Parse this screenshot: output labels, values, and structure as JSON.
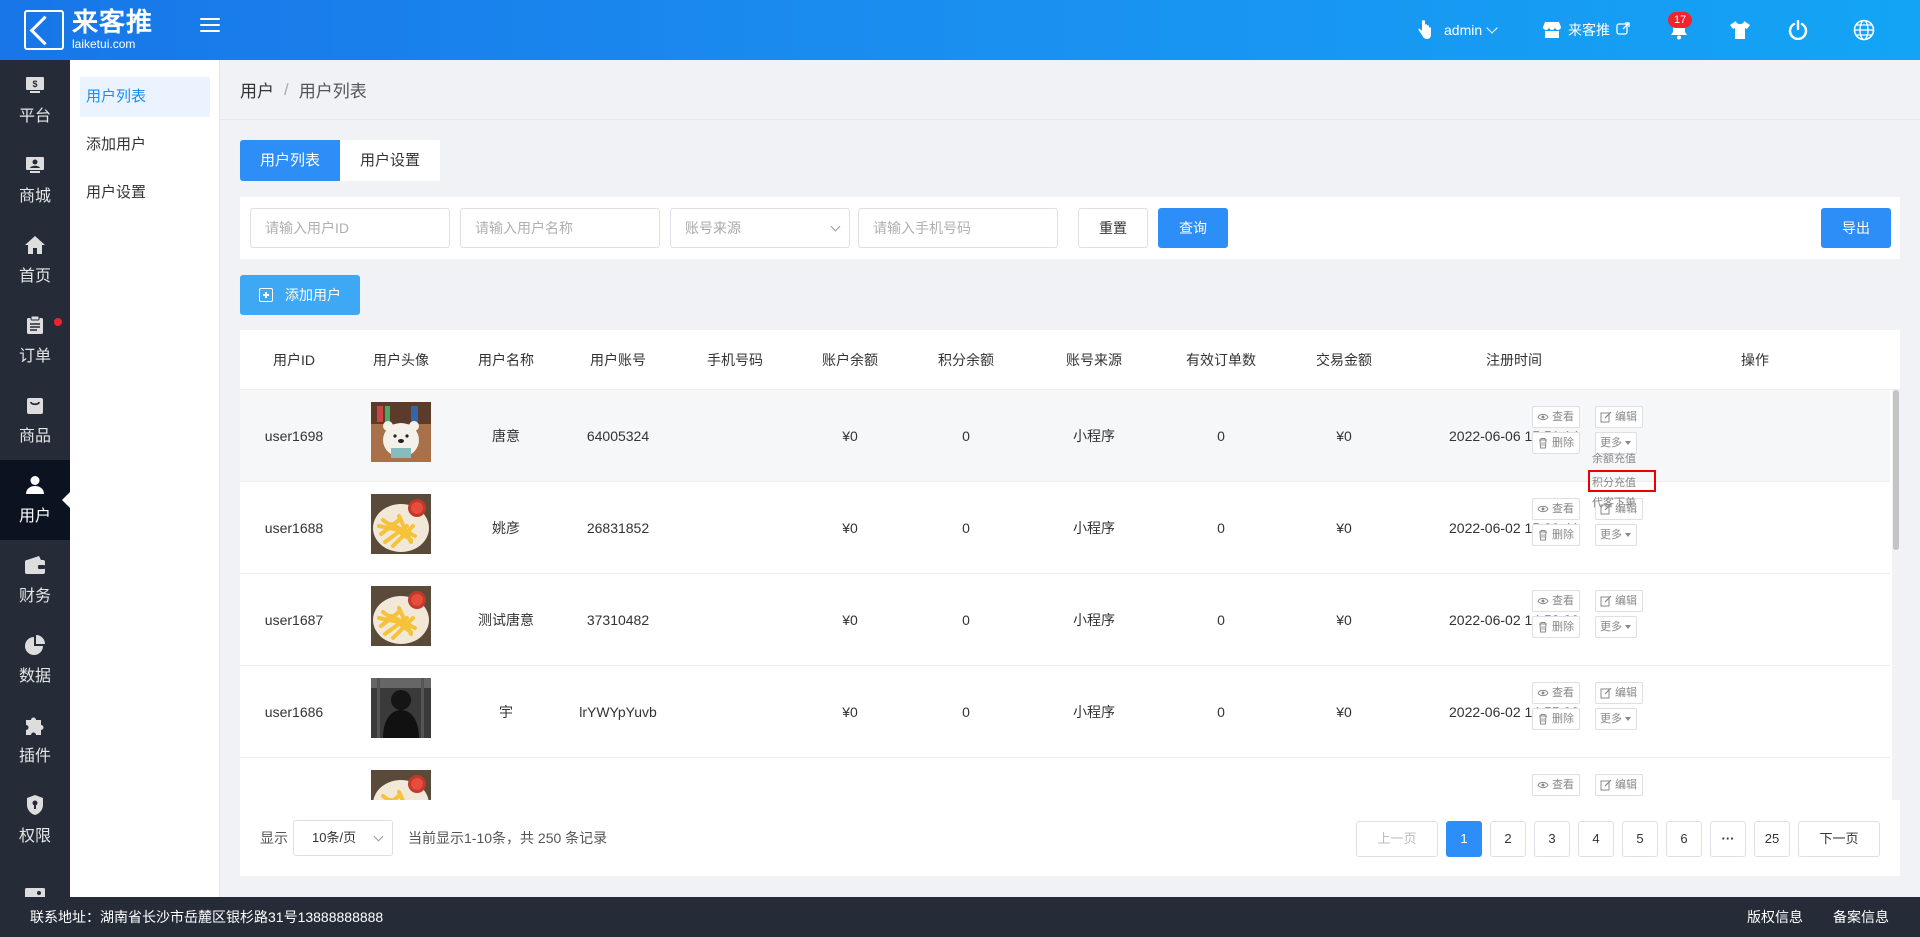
{
  "header": {
    "logo_text": "来客推",
    "logo_sub": "laiketui.com",
    "admin": "admin",
    "store": "来客推",
    "notif_count": "17"
  },
  "leftnav": [
    "平台",
    "商城",
    "首页",
    "订单",
    "商品",
    "用户",
    "财务",
    "数据",
    "插件",
    "权限"
  ],
  "subnav": [
    "用户列表",
    "添加用户",
    "用户设置"
  ],
  "breadcrumb": {
    "root": "用户",
    "sep": "/",
    "current": "用户列表"
  },
  "tabs": [
    "用户列表",
    "用户设置"
  ],
  "filter": {
    "user_id_ph": "请输入用户ID",
    "user_name_ph": "请输入用户名称",
    "source_ph": "账号来源",
    "phone_ph": "请输入手机号码",
    "reset": "重置",
    "query": "查询",
    "export": "导出"
  },
  "add_user": "添加用户",
  "table": {
    "headers": [
      "用户ID",
      "用户头像",
      "用户名称",
      "用户账号",
      "手机号码",
      "账户余额",
      "积分余额",
      "账号来源",
      "有效订单数",
      "交易金额",
      "注册时间",
      "操作"
    ],
    "rows": [
      {
        "id": "user1698",
        "name": "唐意",
        "account": "64005324",
        "phone": "",
        "balance": "¥0",
        "points": "0",
        "source": "小程序",
        "orders": "0",
        "amount": "¥0",
        "time": "2022-06-06 15:51:14",
        "avatar": "bear"
      },
      {
        "id": "user1688",
        "name": "姚彦",
        "account": "26831852",
        "phone": "",
        "balance": "¥0",
        "points": "0",
        "source": "小程序",
        "orders": "0",
        "amount": "¥0",
        "time": "2022-06-02 15:39:41",
        "avatar": "fries"
      },
      {
        "id": "user1687",
        "name": "测试唐意",
        "account": "37310482",
        "phone": "",
        "balance": "¥0",
        "points": "0",
        "source": "小程序",
        "orders": "0",
        "amount": "¥0",
        "time": "2022-06-02 14:58:30",
        "avatar": "fries"
      },
      {
        "id": "user1686",
        "name": "宇",
        "account": "lrYWYpYuvb",
        "phone": "",
        "balance": "¥0",
        "points": "0",
        "source": "小程序",
        "orders": "0",
        "amount": "¥0",
        "time": "2022-06-02 14:55:03",
        "avatar": "dark"
      }
    ],
    "ops": {
      "view": "查看",
      "edit": "编辑",
      "delete": "删除",
      "more": "更多"
    },
    "dropdown": [
      "余额充值",
      "积分充值",
      "代客下单"
    ]
  },
  "pager": {
    "show": "显示",
    "per_page": "10条/页",
    "summary": "当前显示1-10条，共 250 条记录",
    "prev": "上一页",
    "pages": [
      "1",
      "2",
      "3",
      "4",
      "5",
      "6"
    ],
    "ellipsis": "···",
    "last": "25",
    "next": "下一页"
  },
  "footer": {
    "address": "联系地址：湖南省长沙市岳麓区银杉路31号13888888888",
    "copyright": "版权信息",
    "record": "备案信息"
  }
}
